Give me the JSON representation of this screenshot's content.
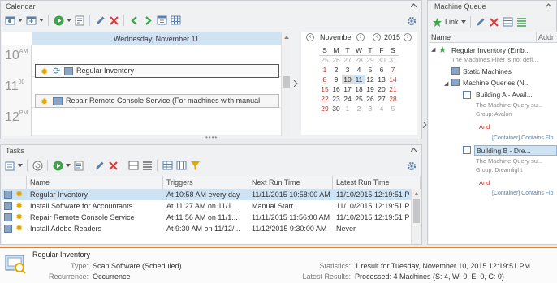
{
  "calendar": {
    "title": "Calendar",
    "day_header": "Wednesday, November 11",
    "hours": [
      {
        "h": "10",
        "s": "AM"
      },
      {
        "h": "11",
        "s": "00"
      },
      {
        "h": "12",
        "s": "PM"
      }
    ],
    "events": [
      "Regular Inventory",
      "Repair Remote Console Service (For machines with manual"
    ],
    "mini": {
      "month": "November",
      "year": "2015",
      "dow": [
        "S",
        "M",
        "T",
        "W",
        "T",
        "F",
        "S"
      ],
      "weeks": [
        [
          "25",
          "26",
          "27",
          "28",
          "29",
          "30",
          "31"
        ],
        [
          "1",
          "2",
          "3",
          "4",
          "5",
          "6",
          "7"
        ],
        [
          "8",
          "9",
          "10",
          "11",
          "12",
          "13",
          "14"
        ],
        [
          "15",
          "16",
          "17",
          "18",
          "19",
          "20",
          "21"
        ],
        [
          "22",
          "23",
          "24",
          "25",
          "26",
          "27",
          "28"
        ],
        [
          "29",
          "30",
          "1",
          "2",
          "3",
          "4",
          "5"
        ]
      ]
    }
  },
  "machine_queue": {
    "title": "Machine Queue",
    "link_label": "Link",
    "col_name": "Name",
    "col_address": "Addr",
    "tree": [
      "Regular Inventory (Emb...",
      "The Machines Filter is not defi...",
      "Static Machines",
      "Machine Queries (N...",
      "Building A - Avail...",
      "The Machine Query su...",
      "Group: Avalon",
      "And",
      "[Container] Contains Flo",
      "Building B - Dre...",
      "The Machine Query su...",
      "Group: Dreamlight",
      "And",
      "[Container] Contains Flo"
    ]
  },
  "tasks": {
    "title": "Tasks",
    "columns": [
      "Name",
      "Triggers",
      "Next Run Time",
      "Latest Run Time"
    ],
    "rows": [
      {
        "name": "Regular Inventory",
        "trigger": "At 10:58 AM every day",
        "next": "11/11/2015 10:58:00 AM",
        "latest": "11/10/2015 12:19:51 P"
      },
      {
        "name": "Install Software for Accountants",
        "trigger": "At 11:27 AM on 11/1...",
        "next": "Manual Start",
        "latest": "11/10/2015 12:19:51 P"
      },
      {
        "name": "Repair Remote Console Service",
        "trigger": "At 11:56 AM on 11/1...",
        "next": "11/11/2015 11:56:00 AM",
        "latest": "11/10/2015 12:19:51 P"
      },
      {
        "name": "Install Adobe Readers",
        "trigger": "At 9:30 AM on 11/12/...",
        "next": "11/12/2015 9:30:00 AM",
        "latest": "Never"
      }
    ]
  },
  "details": {
    "title": "Regular Inventory",
    "type_label": "Type:",
    "type_value": "Scan Software (Scheduled)",
    "rec_label": "Recurrence:",
    "rec_value": "Occurrence",
    "stats_label": "Statistics:",
    "stats_value": "1 result for Tuesday, November 10, 2015 12:19:51 PM",
    "latest_label": "Latest Results:",
    "latest_value": "Processed: 4 Machines (S: 4, W: 0, E: 0, C: 0)"
  },
  "colors": {
    "accent": "#e07a2e",
    "selected": "#cde3f4",
    "red_day": "#c0392b"
  }
}
